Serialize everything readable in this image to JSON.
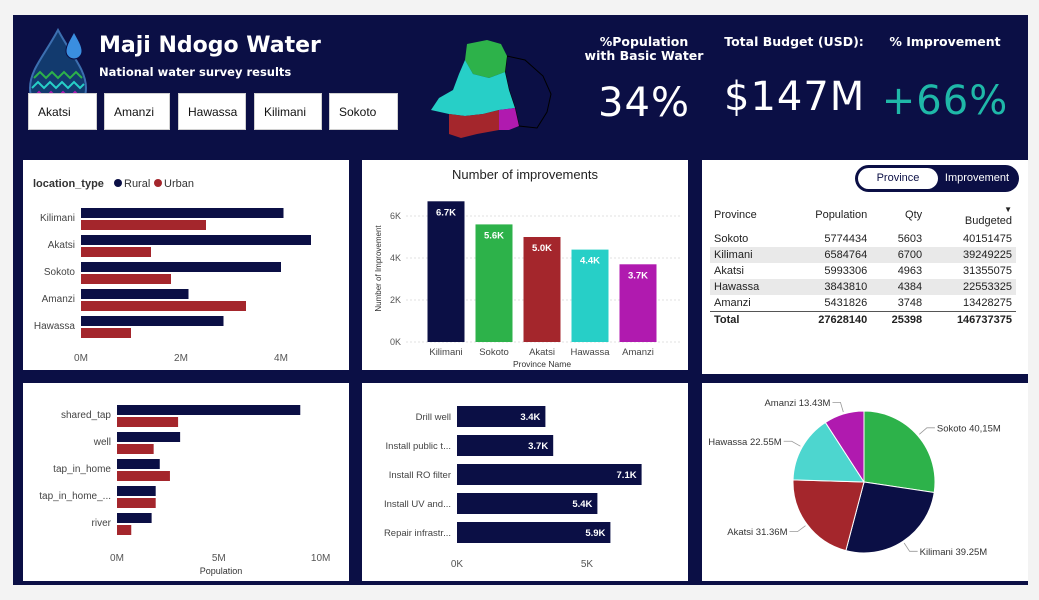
{
  "header": {
    "title": "Maji Ndogo Water",
    "subtitle": "National water survey results"
  },
  "slicers": [
    "Akatsi",
    "Amanzi",
    "Hawassa",
    "Kilimani",
    "Sokoto"
  ],
  "kpis": [
    {
      "label": "%Population with Basic Water",
      "value": "34%",
      "color": "#ffffff"
    },
    {
      "label": "Total Budget (USD):",
      "value": "$147M",
      "color": "#ffffff"
    },
    {
      "label": "% Improvement",
      "value": "+66%",
      "color": "#1fb8a8"
    }
  ],
  "colors": {
    "navy": "#0b0f45",
    "red": "#a4262c",
    "green": "#2db24a",
    "teal": "#27cfc7",
    "magenta": "#b01aaf"
  },
  "toggle": {
    "left": "Province",
    "right": "Improvement"
  },
  "table": {
    "headers": [
      "Province",
      "Population",
      "Qty",
      "Budgeted"
    ],
    "rows": [
      [
        "Sokoto",
        "5774434",
        "5603",
        "40151475"
      ],
      [
        "Kilimani",
        "6584764",
        "6700",
        "39249225"
      ],
      [
        "Akatsi",
        "5993306",
        "4963",
        "31355075"
      ],
      [
        "Hawassa",
        "3843810",
        "4384",
        "22553325"
      ],
      [
        "Amanzi",
        "5431826",
        "3748",
        "13428275"
      ]
    ],
    "total": [
      "Total",
      "27628140",
      "25398",
      "146737375"
    ]
  },
  "chart_data": [
    {
      "id": "location",
      "type": "bar",
      "orientation": "horizontal",
      "legend_title": "location_type",
      "legend_position": "top-left",
      "categories": [
        "Kilimani",
        "Akatsi",
        "Sokoto",
        "Amanzi",
        "Hawassa"
      ],
      "series": [
        {
          "name": "Rural",
          "color": "#0b0f45",
          "values": [
            4.05,
            4.6,
            4.0,
            2.15,
            2.85
          ]
        },
        {
          "name": "Urban",
          "color": "#a4262c",
          "values": [
            2.5,
            1.4,
            1.8,
            3.3,
            1.0
          ]
        }
      ],
      "xticks": [
        "0M",
        "2M",
        "4M"
      ],
      "xtick_values": [
        0,
        2,
        4
      ],
      "xlim": [
        0,
        5.2
      ]
    },
    {
      "id": "improvements",
      "type": "bar",
      "orientation": "vertical",
      "title": "Number of improvements",
      "xlabel": "Province Name",
      "ylabel": "Number of Improvement",
      "categories": [
        "Kilimani",
        "Sokoto",
        "Akatsi",
        "Hawassa",
        "Amanzi"
      ],
      "values": [
        6700,
        5600,
        5000,
        4400,
        3700
      ],
      "labels": [
        "6.7K",
        "5.6K",
        "5.0K",
        "4.4K",
        "3.7K"
      ],
      "colors": [
        "#0b0f45",
        "#2db24a",
        "#a4262c",
        "#27cfc7",
        "#b01aaf"
      ],
      "yticks": [
        "0K",
        "2K",
        "4K",
        "6K"
      ],
      "ytick_values": [
        0,
        2000,
        4000,
        6000
      ],
      "ylim": [
        0,
        7000
      ]
    },
    {
      "id": "source",
      "type": "bar",
      "orientation": "horizontal",
      "xlabel": "Population",
      "categories": [
        "shared_tap",
        "well",
        "tap_in_home",
        "tap_in_home_...",
        "river"
      ],
      "series": [
        {
          "name": "Rural",
          "color": "#0b0f45",
          "values": [
            9.0,
            3.1,
            2.1,
            1.9,
            1.7
          ]
        },
        {
          "name": "Urban",
          "color": "#a4262c",
          "values": [
            3.0,
            1.8,
            2.6,
            1.9,
            0.7
          ]
        }
      ],
      "xticks": [
        "0M",
        "5M",
        "10M"
      ],
      "xtick_values": [
        0,
        5,
        10
      ],
      "xlim": [
        0,
        11
      ]
    },
    {
      "id": "activities",
      "type": "bar",
      "orientation": "horizontal",
      "categories": [
        "Drill well",
        "Install public t...",
        "Install RO filter",
        "Install UV and...",
        "Repair infrastr..."
      ],
      "values": [
        3400,
        3700,
        7100,
        5400,
        5900
      ],
      "labels": [
        "3.4K",
        "3.7K",
        "7.1K",
        "5.4K",
        "5.9K"
      ],
      "color": "#0b0f45",
      "xticks": [
        "0K",
        "5K"
      ],
      "xtick_values": [
        0,
        5000
      ],
      "xlim": [
        0,
        8000
      ]
    },
    {
      "id": "budget_pie",
      "type": "pie",
      "slices": [
        {
          "name": "Sokoto",
          "label": "Sokoto 40,15M",
          "value": 40.15,
          "color": "#2db24a"
        },
        {
          "name": "Kilimani",
          "label": "Kilimani 39.25M",
          "value": 39.25,
          "color": "#0b0f45"
        },
        {
          "name": "Akatsi",
          "label": "Akatsi 31.36M",
          "value": 31.36,
          "color": "#a4262c"
        },
        {
          "name": "Hawassa",
          "label": "Hawassa 22.55M",
          "value": 22.55,
          "color": "#4dd6cf"
        },
        {
          "name": "Amanzi",
          "label": "Amanzi 13.43M",
          "value": 13.43,
          "color": "#b01aaf"
        }
      ]
    }
  ]
}
